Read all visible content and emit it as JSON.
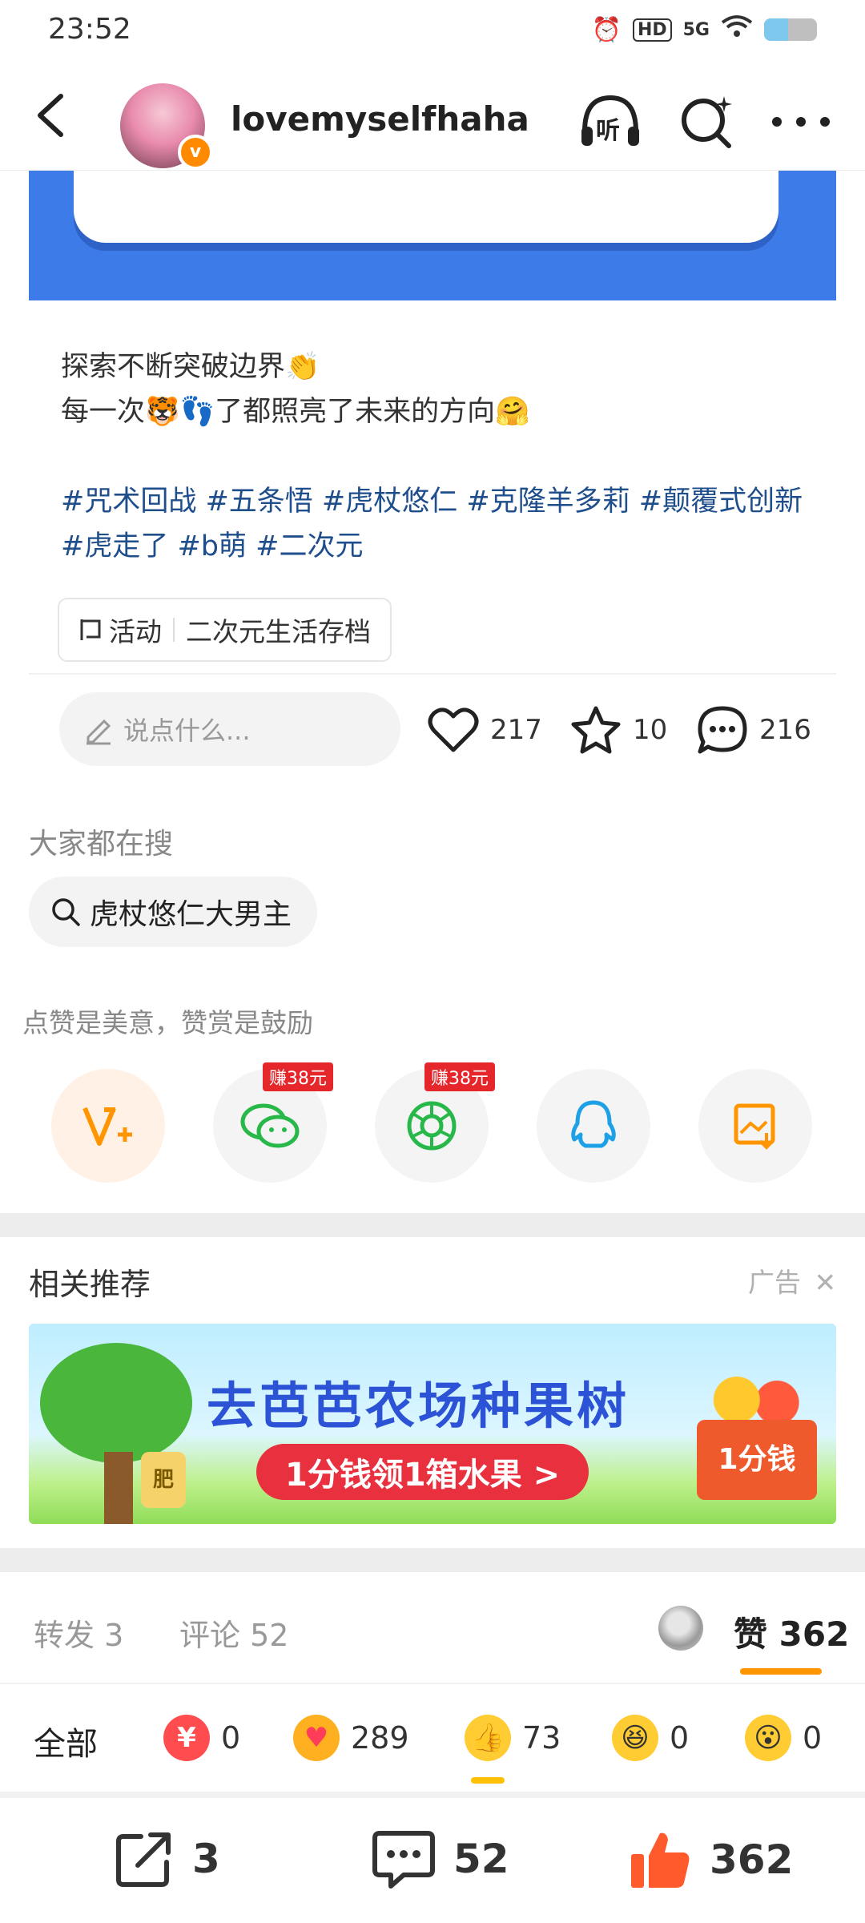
{
  "status_bar": {
    "time": "23:52",
    "icons": [
      "alarm-icon",
      "hd-icon",
      "signal-5g-icon",
      "wifi-icon",
      "battery-icon"
    ],
    "hd_label": "HD",
    "network_label": "5G",
    "battery_level": 0.45
  },
  "header": {
    "username": "lovemyselfhaha",
    "listen_label": "听",
    "verified_mark": "v"
  },
  "post": {
    "line1": "探索不断突破边界👏",
    "line2": "每一次🐯👣了都照亮了未来的方向🤗",
    "tags": "#咒术回战 #五条悟 #虎杖悠仁 #克隆羊多莉 #颠覆式创新 #虎走了 #b萌 #二次元",
    "activity_label": "活动",
    "activity_name": "二次元生活存档"
  },
  "actions": {
    "comment_placeholder": "说点什么...",
    "like_count": "217",
    "favorite_count": "10",
    "comment_count": "216"
  },
  "trending": {
    "title": "大家都在搜",
    "query": "虎杖悠仁大男主"
  },
  "share": {
    "hint": "点赞是美意，赞赏是鼓励",
    "wechat_badge": "赚38元",
    "moments_badge": "赚38元"
  },
  "related": {
    "title": "相关推荐",
    "ad_label": "广告",
    "ad_headline": "去芭芭农场种果树",
    "ad_cta": "1分钱领1箱水果 >",
    "ad_box_text": "1分钱",
    "ad_fertilizer": "肥"
  },
  "tabs": {
    "repost": "转发 3",
    "comments": "评论 52",
    "likes_label": "赞",
    "likes_count": "362"
  },
  "reactions": {
    "all_label": "全部",
    "items": [
      {
        "icon": "reward-icon",
        "count": "0",
        "color": "#ff4d4f"
      },
      {
        "icon": "heart-card-icon",
        "count": "289",
        "color": "#ffb020"
      },
      {
        "icon": "thumbs-up-emoji-icon",
        "count": "73",
        "color": "#ffcc33"
      },
      {
        "icon": "laugh-emoji-icon",
        "count": "0",
        "color": "#ffcc33"
      },
      {
        "icon": "surprised-emoji-icon",
        "count": "0",
        "color": "#ffcc33"
      }
    ]
  },
  "bottom_bar": {
    "repost_count": "3",
    "comment_count": "52",
    "like_count": "362"
  },
  "colors": {
    "accent": "#ff9500",
    "link": "#1f4e8c",
    "like_red": "#ff5a2c"
  }
}
